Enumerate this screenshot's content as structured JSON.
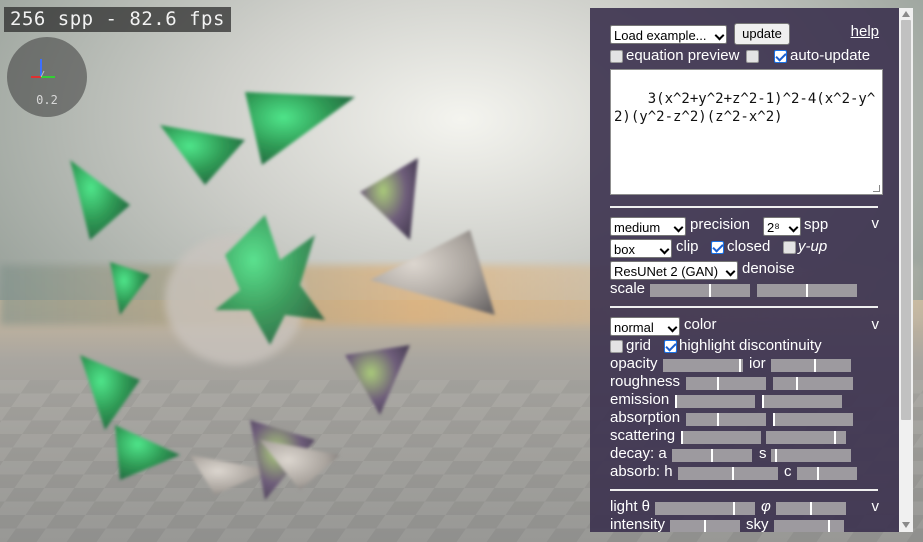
{
  "viewport": {
    "fps_text": "256 spp - 82.6 fps",
    "gizmo_value": "0.2"
  },
  "toolbar": {
    "example_select": "Load example...",
    "update_label": "update",
    "help_label": "help"
  },
  "options": {
    "equation_preview_label": "equation preview",
    "equation_preview_checked": false,
    "extra_checked": false,
    "auto_update_label": "auto-update",
    "auto_update_checked": true
  },
  "equation": "3(x^2+y^2+z^2-1)^2-4(x^2-y^2)(y^2-z^2)(z^2-x^2)",
  "render": {
    "precision_select": "medium",
    "precision_label": "precision",
    "spp_select": "2⁸",
    "spp_label": "spp",
    "toggle_label": "v",
    "clip_select": "box",
    "clip_label": "clip",
    "closed_label": "closed",
    "closed_checked": true,
    "yup_label": "y-up",
    "yup_checked": false,
    "denoise_select": "ResUNet 2 (GAN)",
    "denoise_label": "denoise",
    "scale_label": "scale",
    "scale_values": [
      0.6,
      0.5
    ]
  },
  "color": {
    "mode_select": "normal",
    "mode_label": "color",
    "toggle_label": "v",
    "grid_label": "grid",
    "grid_checked": false,
    "discontinuity_label": "highlight discontinuity",
    "discontinuity_checked": true,
    "opacity_label": "opacity",
    "opacity_value": 0.97,
    "ior_label": "ior",
    "ior_value": 0.55,
    "roughness_label": "roughness",
    "roughness_values": [
      0.4,
      0.3
    ],
    "emission_label": "emission",
    "emission_values": [
      0.0,
      0.0
    ],
    "absorption_label": "absorption",
    "absorption_values": [
      0.4,
      0.0
    ],
    "scattering_label": "scattering",
    "scattering_values": [
      0.0,
      0.87
    ],
    "decay_label": "decay: a",
    "decay_value": 0.5,
    "s_label": "s",
    "s_value": 0.05,
    "absorb_label": "absorb: h",
    "absorb_value": 0.55,
    "c_label": "c",
    "c_value": 0.35
  },
  "light": {
    "theta_label": "light θ",
    "theta_value": 0.8,
    "phi_label": "φ",
    "phi_value": 0.5,
    "toggle_label": "v",
    "intensity_label": "intensity",
    "intensity_value": 0.5,
    "sky_label": "sky",
    "sky_value": 0.8
  }
}
